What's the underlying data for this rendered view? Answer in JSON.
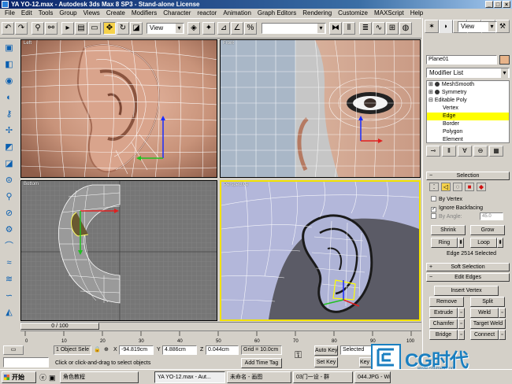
{
  "window": {
    "title": "YA YO-12.max - Autodesk 3ds Max 8 SP3 - Stand-alone License",
    "controls": [
      "_",
      "□",
      "×"
    ]
  },
  "menu": [
    "File",
    "Edit",
    "Tools",
    "Group",
    "Views",
    "Create",
    "Modifiers",
    "Character",
    "reactor",
    "Animation",
    "Graph Editors",
    "Rendering",
    "Customize",
    "MAXScript",
    "Help"
  ],
  "toolbar": {
    "ref_coord": "View",
    "view_dropdown": "View"
  },
  "viewports": {
    "top_left": "Left",
    "top_right": "Front",
    "bottom_left": "Bottom",
    "bottom_right": "Perspective"
  },
  "time_slider": {
    "label": "0 / 100"
  },
  "timeline_ticks": [
    "0",
    "10",
    "20",
    "30",
    "40",
    "50",
    "60",
    "70",
    "80",
    "90",
    "100"
  ],
  "status": {
    "selection": "1 Object Sele",
    "x_label": "X",
    "x_value": "-94.819cm",
    "y_label": "Y",
    "y_value": "4.886cm",
    "z_label": "Z",
    "z_value": "0.044cm",
    "grid": "Grid = 10.0cm",
    "prompt": "Click or click-and-drag to select objects",
    "add_time_tag": "Add Time Tag",
    "auto_key": "Auto Key",
    "set_key": "Set Key",
    "key_mode": "Selected",
    "key_filters": "Key Filters..."
  },
  "command_panel": {
    "object_name": "Plane01",
    "modifier_list": "Modifier List",
    "stack": [
      {
        "label": "MeshSmooth",
        "level": 0
      },
      {
        "label": "Symmetry",
        "level": 0
      },
      {
        "label": "Editable Poly",
        "level": 0
      },
      {
        "label": "Vertex",
        "level": 1
      },
      {
        "label": "Edge",
        "level": 1
      },
      {
        "label": "Border",
        "level": 1
      },
      {
        "label": "Polygon",
        "level": 1
      },
      {
        "label": "Element",
        "level": 1
      }
    ],
    "selection_rollout": "Selection",
    "by_vertex": "By Vertex",
    "ignore_backfacing": "Ignore Backfacing",
    "by_angle": "By Angle:",
    "by_angle_value": "45.0",
    "shrink": "Shrink",
    "grow": "Grow",
    "ring": "Ring",
    "loop": "Loop",
    "selection_info": "Edge 2514 Selected",
    "soft_selection": "Soft Selection",
    "edit_edges": "Edit Edges",
    "insert_vertex": "Insert Vertex",
    "remove": "Remove",
    "split": "Split",
    "extrude": "Extrude",
    "weld": "Weld",
    "chamfer": "Chamfer",
    "target_weld": "Target Weld",
    "bridge": "Bridge",
    "connect": "Connect"
  },
  "taskbar": {
    "start": "开始",
    "tasks": [
      "YA YO-12.max - Aut...",
      "未命名 - 画图",
      "03门一设 - 群",
      "044.JPG - Windows..."
    ],
    "desktop_item": "角色教程"
  },
  "watermark": {
    "brand": "CG时代",
    "url": "www.cgtimes.com"
  },
  "colors": {
    "title_bar": "#0a246a",
    "active_viewport_border": "#f2e200",
    "selection_highlight": "#ffff00",
    "wire": "#ffffff"
  }
}
